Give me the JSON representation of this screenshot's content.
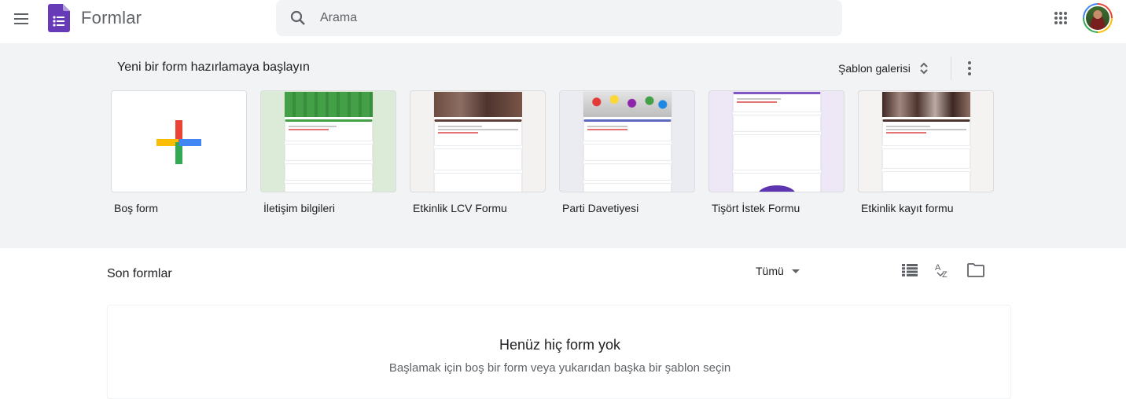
{
  "header": {
    "app_title": "Formlar",
    "search_placeholder": "Arama"
  },
  "templates": {
    "section_title": "Yeni bir form hazırlamaya başlayın",
    "gallery_label": "Şablon galerisi",
    "items": [
      {
        "label": "Boş form"
      },
      {
        "label": "İletişim bilgileri",
        "thumb_title": "İletişim bilgileri"
      },
      {
        "label": "Etkinlik LCV Formu",
        "thumb_title": "Etkinlik LCV formu"
      },
      {
        "label": "Parti Davetiyesi",
        "thumb_title": "Parti Davetiyesi"
      },
      {
        "label": "Tişört İstek Formu",
        "thumb_title": "Tişört İstek Formu"
      },
      {
        "label": "Etkinlik kayıt formu",
        "thumb_title": "Etkinlik kayıt formu"
      }
    ]
  },
  "recent": {
    "title": "Son formlar",
    "owner_filter": "Tümü",
    "empty_title": "Henüz hiç form yok",
    "empty_subtitle": "Başlamak için boş bir form veya yukarıdan başka bir şablon seçin"
  },
  "colors": {
    "forms_purple": "#673ab7",
    "google_red": "#ea4335",
    "google_yellow": "#fbbc04",
    "google_green": "#34a853",
    "google_blue": "#4285f4",
    "gallery_background": "#f1f3f4"
  },
  "icons": [
    "menu-icon",
    "forms-logo-icon",
    "search-icon",
    "apps-grid-icon",
    "unfold-more-icon",
    "more-vert-icon",
    "list-view-icon",
    "sort-az-icon",
    "folder-icon",
    "arrow-drop-down-icon"
  ]
}
